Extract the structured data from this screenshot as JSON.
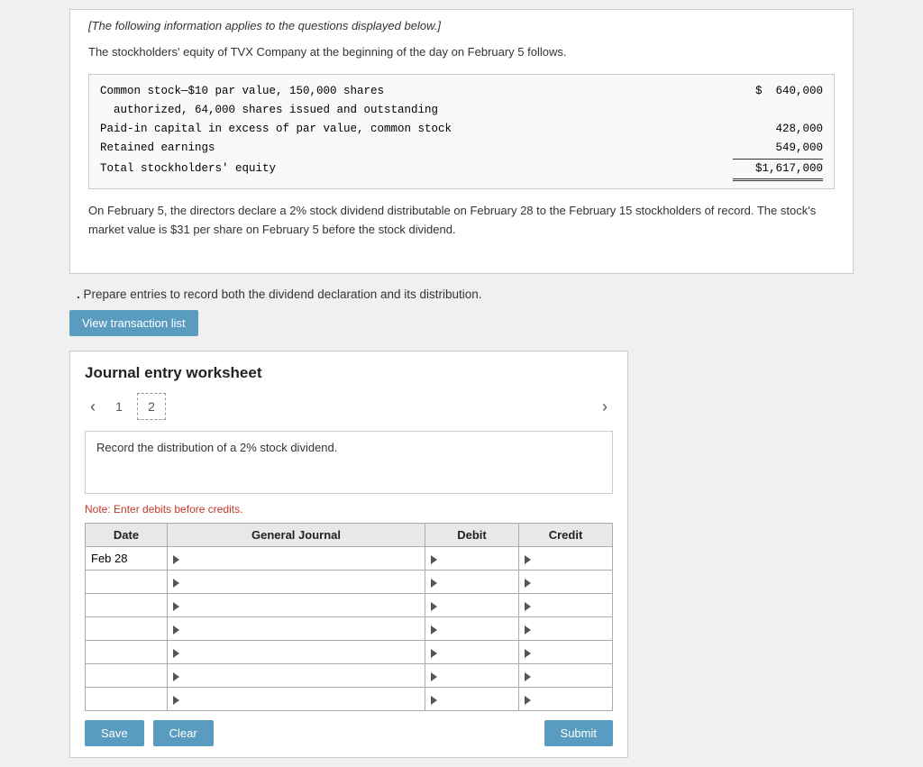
{
  "intro": {
    "text": "[The following information applies to the questions displayed below.]"
  },
  "equity_intro": "The stockholders' equity of TVX Company at the beginning of the day on February 5 follows.",
  "equity_table": {
    "rows": [
      {
        "label": "Common stock—$10 par value, 150,000 shares\n  authorized, 64,000 shares issued and outstanding",
        "value": "$  640,000",
        "style": "normal"
      },
      {
        "label": "Paid-in capital in excess of par value, common stock",
        "value": "428,000",
        "style": "normal"
      },
      {
        "label": "Retained earnings",
        "value": "549,000",
        "style": "underline"
      },
      {
        "label": "Total stockholders' equity",
        "value": "$1,617,000",
        "style": "total"
      }
    ]
  },
  "description": "On February 5, the directors declare a 2% stock dividend distributable on February 28 to the February 15 stockholders of record. The stock's market value is $31 per share on February 5 before the stock dividend.",
  "question": "Prepare entries to record both the dividend declaration and its distribution.",
  "btn_view_transaction": "View transaction list",
  "worksheet": {
    "title": "Journal entry worksheet",
    "tabs": [
      {
        "label": "1"
      },
      {
        "label": "2",
        "active": true
      }
    ],
    "description": "Record the distribution of a 2% stock dividend.",
    "note": "Note: Enter debits before credits.",
    "table": {
      "headers": [
        "Date",
        "General Journal",
        "Debit",
        "Credit"
      ],
      "rows": [
        {
          "date": "Feb 28",
          "desc": "",
          "debit": "",
          "credit": ""
        },
        {
          "date": "",
          "desc": "",
          "debit": "",
          "credit": ""
        },
        {
          "date": "",
          "desc": "",
          "debit": "",
          "credit": ""
        },
        {
          "date": "",
          "desc": "",
          "debit": "",
          "credit": ""
        },
        {
          "date": "",
          "desc": "",
          "debit": "",
          "credit": ""
        },
        {
          "date": "",
          "desc": "",
          "debit": "",
          "credit": ""
        },
        {
          "date": "",
          "desc": "",
          "debit": "",
          "credit": ""
        }
      ]
    },
    "buttons": [
      {
        "label": "Save",
        "style": "save"
      },
      {
        "label": "Clear",
        "style": "clear"
      },
      {
        "label": "Submit",
        "style": "submit"
      }
    ]
  },
  "colors": {
    "accent_blue": "#5a9cbf",
    "red_note": "#c0392b",
    "header_bg": "#e8e8e8"
  }
}
